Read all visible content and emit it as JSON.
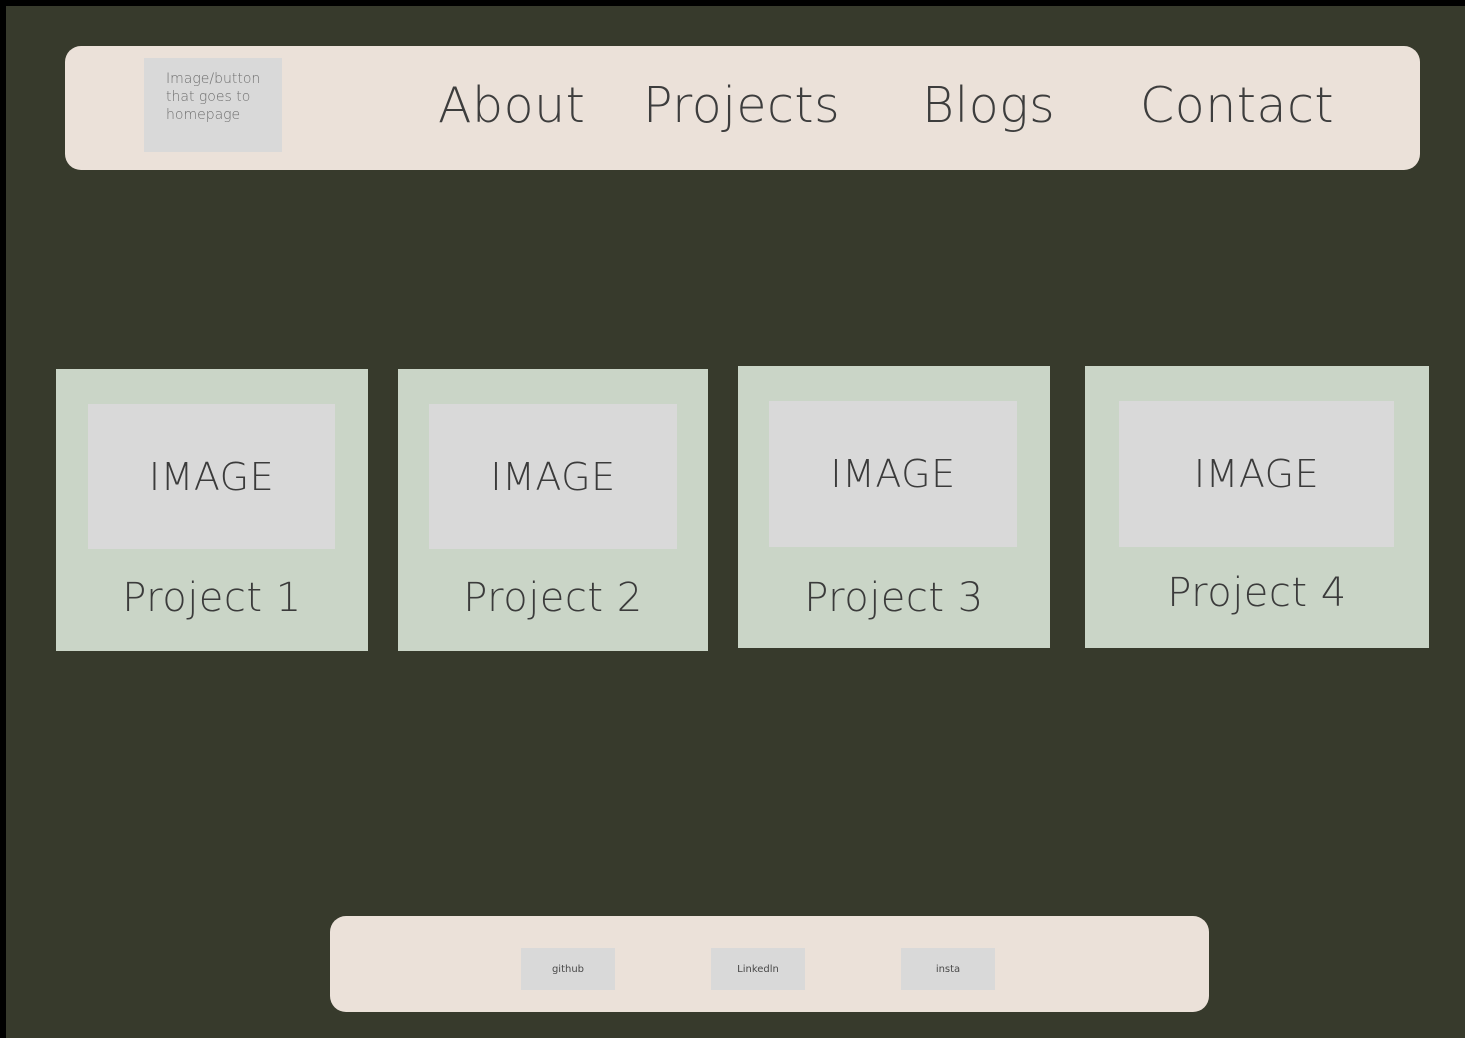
{
  "header": {
    "home_button_label": "Image/button that goes to homepage",
    "nav": [
      {
        "label": "About"
      },
      {
        "label": "Projects"
      },
      {
        "label": "Blogs"
      },
      {
        "label": "Contact"
      }
    ]
  },
  "projects": [
    {
      "image_label": "IMAGE",
      "title": "Project 1"
    },
    {
      "image_label": "IMAGE",
      "title": "Project 2"
    },
    {
      "image_label": "IMAGE",
      "title": "Project 3"
    },
    {
      "image_label": "IMAGE",
      "title": "Project 4"
    }
  ],
  "footer": {
    "links": [
      {
        "label": "github"
      },
      {
        "label": "Linkedln"
      },
      {
        "label": "insta"
      }
    ]
  },
  "colors": {
    "background": "#373a2c",
    "bar": "#ebe1d9",
    "card": "#cad5c7",
    "placeholder": "#d9d9d9"
  }
}
